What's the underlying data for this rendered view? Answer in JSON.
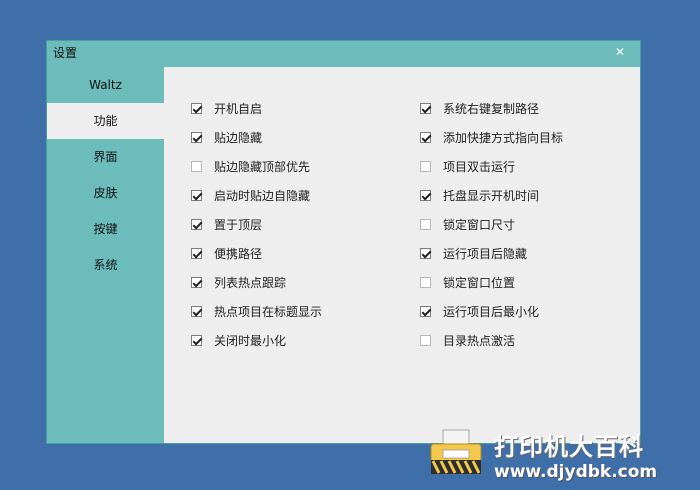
{
  "window": {
    "title": "设置",
    "close_icon": "✕"
  },
  "sidebar": {
    "items": [
      {
        "label": "Waltz",
        "active": false
      },
      {
        "label": "功能",
        "active": true
      },
      {
        "label": "界面",
        "active": false
      },
      {
        "label": "皮肤",
        "active": false
      },
      {
        "label": "按键",
        "active": false
      },
      {
        "label": "系统",
        "active": false
      }
    ]
  },
  "options": {
    "left": [
      {
        "label": "开机自启",
        "checked": true
      },
      {
        "label": "贴边隐藏",
        "checked": true
      },
      {
        "label": "贴边隐藏顶部优先",
        "checked": false
      },
      {
        "label": "启动时贴边自隐藏",
        "checked": true
      },
      {
        "label": "置于顶层",
        "checked": true
      },
      {
        "label": "便携路径",
        "checked": true
      },
      {
        "label": "列表热点跟踪",
        "checked": true
      },
      {
        "label": "热点项目在标题显示",
        "checked": true
      },
      {
        "label": "关闭时最小化",
        "checked": true
      }
    ],
    "right": [
      {
        "label": "系统右键复制路径",
        "checked": true
      },
      {
        "label": "添加快捷方式指向目标",
        "checked": true
      },
      {
        "label": "项目双击运行",
        "checked": false
      },
      {
        "label": "托盘显示开机时间",
        "checked": true
      },
      {
        "label": "锁定窗口尺寸",
        "checked": false
      },
      {
        "label": "运行项目后隐藏",
        "checked": true
      },
      {
        "label": "锁定窗口位置",
        "checked": false
      },
      {
        "label": "运行项目后最小化",
        "checked": true
      },
      {
        "label": "目录热点激活",
        "checked": false
      }
    ]
  },
  "watermark": {
    "title": "打印机大百科",
    "url": "www.djydbk.com",
    "icon": "printer-icon"
  }
}
